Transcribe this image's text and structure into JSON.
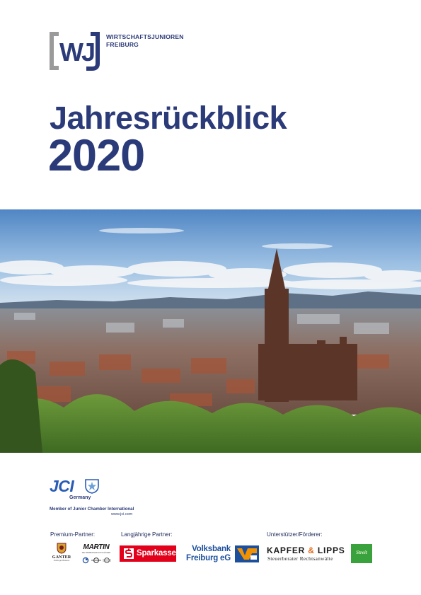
{
  "header": {
    "logo_name_line1": "WIRTSCHAFTSJUNIOREN",
    "logo_name_line2": "FREIBURG",
    "logo_mark_letters": "WJ"
  },
  "cover": {
    "title": "Jahresrückblick",
    "year": "2020"
  },
  "jci": {
    "wordmark": "JCI",
    "country": "Germany",
    "member_text": "Member of Junior Chamber International",
    "url": "www.jci.com"
  },
  "partners": {
    "premium_label": "Premium-Partner:",
    "longterm_label": "Langjährige Partner:",
    "supporters_label": "Unterstützer/Förderer:",
    "ganter": {
      "name": "GANTER",
      "sub": "Freiburger Brauerei"
    },
    "martin": {
      "name": "MARTIN",
      "sub": "DIE FREIBURGER AUTOHÄUSER"
    },
    "sparkasse": {
      "name": "Sparkasse"
    },
    "volksbank": {
      "line1": "Volksbank",
      "line2": "Freiburg eG"
    },
    "kapfer": {
      "name_a": "KAPFER",
      "amp": "&",
      "name_b": "LIPPS",
      "sub": "Steuerberater Rechtsanwälte"
    },
    "streit": {
      "name": "Streit"
    }
  },
  "colors": {
    "brand_blue": "#2b3a78",
    "jci_blue": "#2a5cb5",
    "sparkasse_red": "#e2001a",
    "volksbank_blue": "#1c4f9c",
    "volksbank_orange": "#f39200",
    "streit_green": "#3aa23c",
    "logo_gray": "#9a9a9a"
  }
}
